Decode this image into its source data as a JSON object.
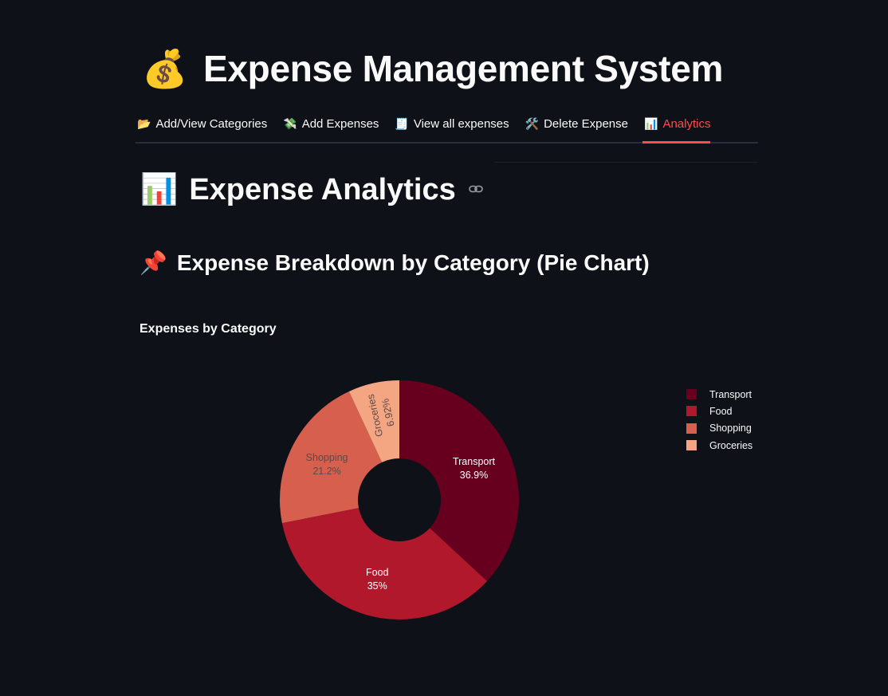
{
  "app": {
    "title_emoji": "💰",
    "title": "Expense Management System"
  },
  "tabs": [
    {
      "icon": "📂",
      "label": "Add/View Categories",
      "active": false
    },
    {
      "icon": "💸",
      "label": "Add Expenses",
      "active": false
    },
    {
      "icon": "🧾",
      "label": "View all expenses",
      "active": false
    },
    {
      "icon": "🛠️",
      "label": "Delete Expense",
      "active": false
    },
    {
      "icon": "📊",
      "label": "Analytics",
      "active": true
    }
  ],
  "section": {
    "emoji": "📊",
    "title": "Expense Analytics",
    "subsection_emoji": "📌",
    "subsection_title": "Expense Breakdown by Category (Pie Chart)"
  },
  "colors": {
    "accent": "#ff4b4b",
    "background": "#0e1117"
  },
  "chart_data": {
    "type": "pie",
    "hole": true,
    "title": "Expenses by Category",
    "categories": [
      "Transport",
      "Food",
      "Shopping",
      "Groceries"
    ],
    "values": [
      36.9,
      35,
      21.2,
      6.92
    ],
    "labels_pct": [
      "36.9%",
      "35%",
      "21.2%",
      "6.92%"
    ],
    "colors": [
      "#67001f",
      "#b2182b",
      "#d6604d",
      "#f4a582"
    ],
    "legend_position": "right"
  }
}
